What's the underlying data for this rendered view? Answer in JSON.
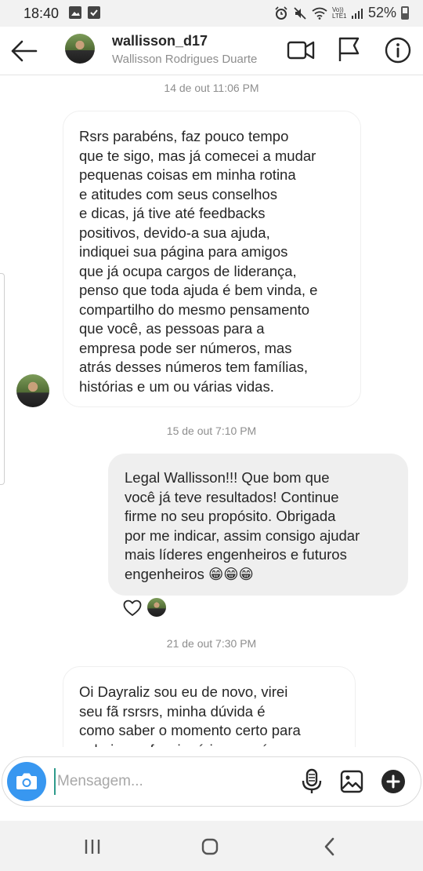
{
  "status_bar": {
    "time": "18:40",
    "battery": "52%",
    "network": "Vo)) LTE1"
  },
  "header": {
    "username": "wallisson_d17",
    "full_name": "Wallisson Rodrigues Duarte"
  },
  "messages": [
    {
      "timestamp": "14 de out 11:06 PM",
      "direction": "incoming",
      "lines": [
        "Rsrs parabéns, faz pouco tempo",
        "que te sigo, mas já comecei a mudar",
        "pequenas coisas em minha rotina",
        "e atitudes com seus conselhos",
        "e dicas, já tive até feedbacks",
        "positivos, devido-a sua ajuda,",
        "indiquei sua página para amigos",
        "que já ocupa cargos de liderança,",
        "penso que toda ajuda é bem vinda, e",
        "compartilho do mesmo pensamento",
        "que você, as pessoas para a",
        "empresa pode ser números, mas",
        "atrás desses números tem famílias,",
        "histórias e um ou várias vidas."
      ]
    },
    {
      "timestamp": "15 de out 7:10 PM",
      "direction": "outgoing",
      "lines": [
        "Legal Wallisson!!! Que bom que",
        "você já teve resultados! Continue",
        "firme no seu propósito. Obrigada",
        "por me indicar, assim consigo ajudar",
        "mais líderes engenheiros e futuros",
        "engenheiros 😁😁😁"
      ]
    },
    {
      "timestamp": "21 de out 7:30 PM",
      "direction": "incoming",
      "lines": [
        "Oi Dayraliz sou eu de novo, virei",
        "seu fã rsrsrs, minha dúvida é",
        "como saber o momento certo para",
        "valorizar o funcionário, e se é como"
      ]
    }
  ],
  "composer": {
    "placeholder": "Mensagem..."
  },
  "icons": {
    "back": "arrow-left-icon",
    "video": "video-camera-icon",
    "flag": "flag-icon",
    "info": "info-icon",
    "camera": "camera-icon",
    "mic": "microphone-icon",
    "gallery": "image-icon",
    "plus": "plus-icon",
    "heart": "heart-icon"
  },
  "colors": {
    "accent": "#3897f0",
    "bubble_outgoing": "#efefef",
    "muted_text": "#8e8e8e"
  }
}
